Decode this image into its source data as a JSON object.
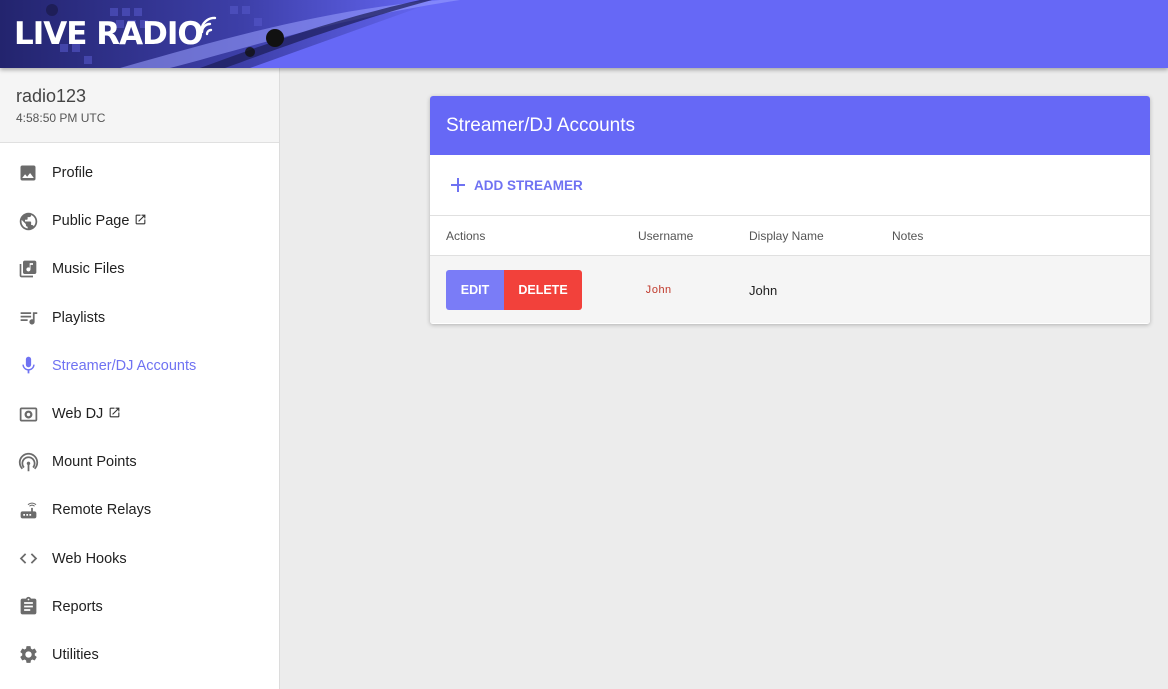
{
  "header": {
    "logo_text": "LIVE RADIO",
    "brand_color": "#6668f6"
  },
  "station": {
    "name": "radio123",
    "time": "4:58:50 PM UTC"
  },
  "sidebar": {
    "items": [
      {
        "label": "Profile",
        "icon": "image-icon"
      },
      {
        "label": "Public Page",
        "icon": "globe-icon",
        "external": true
      },
      {
        "label": "Music Files",
        "icon": "library-music-icon"
      },
      {
        "label": "Playlists",
        "icon": "queue-music-icon"
      },
      {
        "label": "Streamer/DJ Accounts",
        "icon": "mic-icon",
        "active": true
      },
      {
        "label": "Web DJ",
        "icon": "speaker-icon",
        "external": true
      },
      {
        "label": "Mount Points",
        "icon": "broadcast-icon"
      },
      {
        "label": "Remote Relays",
        "icon": "router-icon"
      },
      {
        "label": "Web Hooks",
        "icon": "code-icon"
      },
      {
        "label": "Reports",
        "icon": "clipboard-icon"
      },
      {
        "label": "Utilities",
        "icon": "gear-icon"
      }
    ]
  },
  "card": {
    "title": "Streamer/DJ Accounts",
    "add_label": "ADD STREAMER",
    "columns": [
      "Actions",
      "Username",
      "Display Name",
      "Notes"
    ],
    "rows": [
      {
        "edit_label": "EDIT",
        "delete_label": "DELETE",
        "username": "John",
        "display_name": "John",
        "notes": ""
      }
    ]
  },
  "colors": {
    "accent": "#6f72f2",
    "edit": "#7a7cf7",
    "delete": "#f2413b"
  }
}
